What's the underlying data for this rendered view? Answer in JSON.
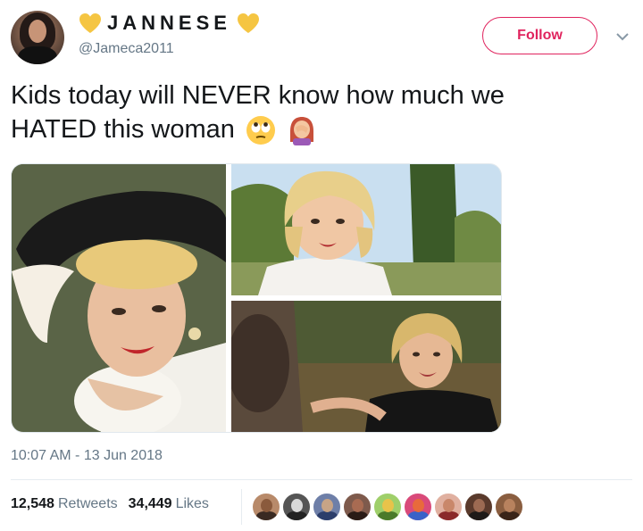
{
  "user": {
    "display_name": "JANNESE",
    "handle": "@Jameca2011",
    "heart_color": "#f5c542"
  },
  "actions": {
    "follow_label": "Follow",
    "accent_color": "#e0245e"
  },
  "tweet": {
    "text_line1": "Kids today will NEVER know how much we",
    "text_line2": "HATED this woman",
    "emojis": [
      "rolling-eyes-emoji",
      "woman-facepalming-emoji"
    ]
  },
  "media": {
    "photos": [
      {
        "name": "photo-woman-hat"
      },
      {
        "name": "photo-woman-outdoors-top"
      },
      {
        "name": "photo-woman-outdoors-bottom"
      }
    ]
  },
  "meta": {
    "timestamp": "10:07 AM - 13 Jun 2018"
  },
  "stats": {
    "retweets_count": "12,548",
    "retweets_label": "Retweets",
    "likes_count": "34,449",
    "likes_label": "Likes"
  },
  "likers": [
    {
      "face": "#8a5a3c",
      "body": "#3a2a22",
      "bg": "#b88a6a"
    },
    {
      "face": "#d9d9d9",
      "body": "#222222",
      "bg": "#555555"
    },
    {
      "face": "#c7a486",
      "body": "#2c3e6b",
      "bg": "#6e7fa8"
    },
    {
      "face": "#a86b52",
      "body": "#2a1b16",
      "bg": "#7e5a4c"
    },
    {
      "face": "#e8c34a",
      "body": "#4a7a2a",
      "bg": "#9fcf6a"
    },
    {
      "face": "#e86a3c",
      "body": "#3a62c8",
      "bg": "#d94a7a"
    },
    {
      "face": "#c9876a",
      "body": "#8a2a2a",
      "bg": "#e0b0a0"
    },
    {
      "face": "#9c6a52",
      "body": "#1e1a18",
      "bg": "#5a3a2c"
    },
    {
      "face": "#b8825e",
      "body": "#3a2418",
      "bg": "#8a5e40"
    }
  ]
}
